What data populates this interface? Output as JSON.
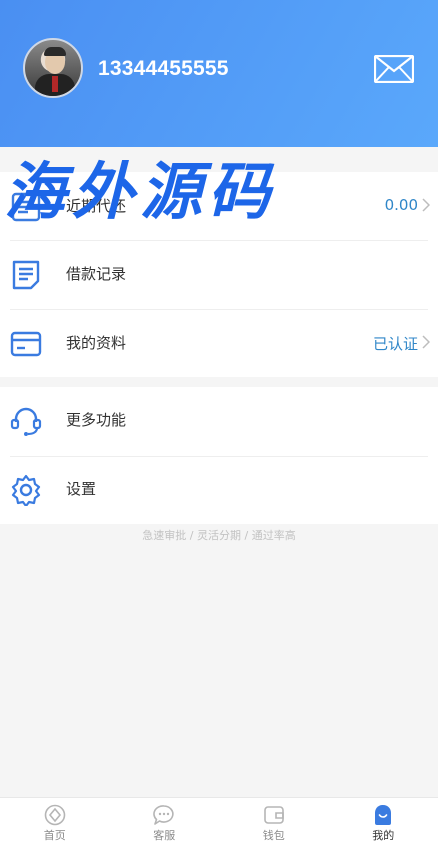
{
  "header": {
    "phone": "13344455555"
  },
  "watermark": "海外源码",
  "menu_primary": [
    {
      "label": "近期代还",
      "value": "0.00",
      "icon": "document-list-icon"
    },
    {
      "label": "借款记录",
      "value": "",
      "icon": "document-icon"
    },
    {
      "label": "我的资料",
      "value": "已认证",
      "icon": "card-icon"
    }
  ],
  "menu_secondary": [
    {
      "label": "更多功能",
      "icon": "headset-icon"
    },
    {
      "label": "设置",
      "icon": "gear-icon"
    }
  ],
  "slogan": "急速审批 / 灵活分期 / 通过率高",
  "tabbar": [
    {
      "label": "首页",
      "icon": "home-icon",
      "active": false
    },
    {
      "label": "客服",
      "icon": "chat-icon",
      "active": false
    },
    {
      "label": "钱包",
      "icon": "wallet-icon",
      "active": false
    },
    {
      "label": "我的",
      "icon": "user-icon",
      "active": true
    }
  ],
  "colors": {
    "accent": "#4a8ff2",
    "value_text": "#2f86c8",
    "watermark": "#1d66e8"
  }
}
